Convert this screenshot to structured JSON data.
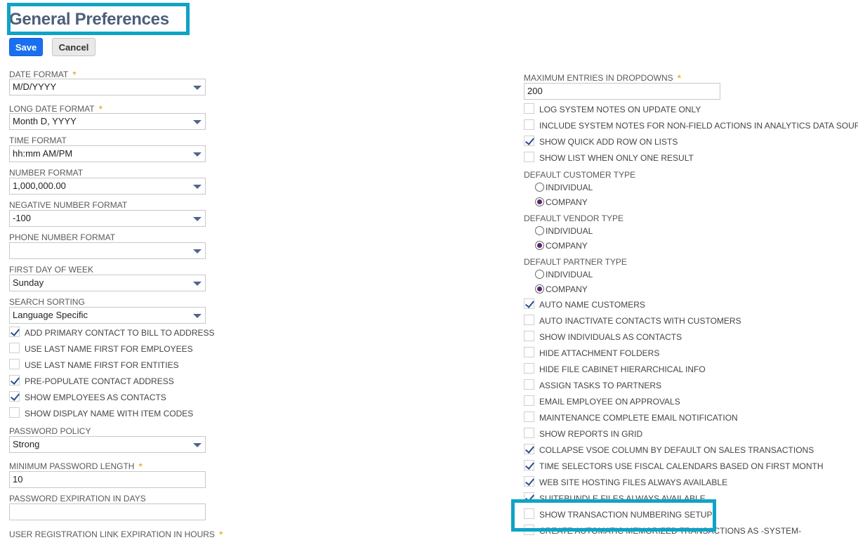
{
  "page": {
    "title": "General Preferences",
    "save_label": "Save",
    "cancel_label": "Cancel"
  },
  "left": {
    "date_format": {
      "label": "DATE FORMAT",
      "value": "M/D/YYYY"
    },
    "long_date_format": {
      "label": "LONG DATE FORMAT",
      "value": "Month D, YYYY"
    },
    "time_format": {
      "label": "TIME FORMAT",
      "value": "hh:mm AM/PM"
    },
    "number_format": {
      "label": "NUMBER FORMAT",
      "value": "1,000,000.00"
    },
    "negative_number_format": {
      "label": "NEGATIVE NUMBER FORMAT",
      "value": "-100"
    },
    "phone_number_format": {
      "label": "PHONE NUMBER FORMAT",
      "value": ""
    },
    "first_day_of_week": {
      "label": "FIRST DAY OF WEEK",
      "value": "Sunday"
    },
    "search_sorting": {
      "label": "SEARCH SORTING",
      "value": "Language Specific"
    },
    "checkboxes": [
      {
        "label": "ADD PRIMARY CONTACT TO BILL TO ADDRESS",
        "checked": true
      },
      {
        "label": "USE LAST NAME FIRST FOR EMPLOYEES",
        "checked": false
      },
      {
        "label": "USE LAST NAME FIRST FOR ENTITIES",
        "checked": false
      },
      {
        "label": "PRE-POPULATE CONTACT ADDRESS",
        "checked": true
      },
      {
        "label": "SHOW EMPLOYEES AS CONTACTS",
        "checked": true
      },
      {
        "label": "SHOW DISPLAY NAME WITH ITEM CODES",
        "checked": false
      }
    ],
    "password_policy": {
      "label": "PASSWORD POLICY",
      "value": "Strong"
    },
    "min_password_length": {
      "label": "MINIMUM PASSWORD LENGTH",
      "value": "10"
    },
    "password_expiration": {
      "label": "PASSWORD EXPIRATION IN DAYS",
      "value": ""
    },
    "user_registration_link": {
      "label": "USER REGISTRATION LINK EXPIRATION IN HOURS"
    }
  },
  "right": {
    "max_entries": {
      "label": "MAXIMUM ENTRIES IN DROPDOWNS",
      "value": "200"
    },
    "checkboxes_top": [
      {
        "label": "LOG SYSTEM NOTES ON UPDATE ONLY",
        "checked": false
      },
      {
        "label": "INCLUDE SYSTEM NOTES FOR NON-FIELD ACTIONS IN ANALYTICS DATA SOURCE",
        "checked": false
      },
      {
        "label": "SHOW QUICK ADD ROW ON LISTS",
        "checked": true
      },
      {
        "label": "SHOW LIST WHEN ONLY ONE RESULT",
        "checked": false
      }
    ],
    "default_customer_type": {
      "label": "DEFAULT CUSTOMER TYPE",
      "opt1": "INDIVIDUAL",
      "opt2": "COMPANY"
    },
    "default_vendor_type": {
      "label": "DEFAULT VENDOR TYPE",
      "opt1": "INDIVIDUAL",
      "opt2": "COMPANY"
    },
    "default_partner_type": {
      "label": "DEFAULT PARTNER TYPE",
      "opt1": "INDIVIDUAL",
      "opt2": "COMPANY"
    },
    "checkboxes_bottom": [
      {
        "label": "AUTO NAME CUSTOMERS",
        "checked": true
      },
      {
        "label": "AUTO INACTIVATE CONTACTS WITH CUSTOMERS",
        "checked": false
      },
      {
        "label": "SHOW INDIVIDUALS AS CONTACTS",
        "checked": false
      },
      {
        "label": "HIDE ATTACHMENT FOLDERS",
        "checked": false
      },
      {
        "label": "HIDE FILE CABINET HIERARCHICAL INFO",
        "checked": false
      },
      {
        "label": "ASSIGN TASKS TO PARTNERS",
        "checked": false
      },
      {
        "label": "EMAIL EMPLOYEE ON APPROVALS",
        "checked": false
      },
      {
        "label": "MAINTENANCE COMPLETE EMAIL NOTIFICATION",
        "checked": false
      },
      {
        "label": "SHOW REPORTS IN GRID",
        "checked": false
      },
      {
        "label": "COLLAPSE VSOE COLUMN BY DEFAULT ON SALES TRANSACTIONS",
        "checked": true
      },
      {
        "label": "TIME SELECTORS USE FISCAL CALENDARS BASED ON FIRST MONTH",
        "checked": true
      },
      {
        "label": "WEB SITE HOSTING FILES ALWAYS AVAILABLE",
        "checked": true
      },
      {
        "label": "SUITEBUNDLE FILES ALWAYS AVAILABLE",
        "checked": true
      },
      {
        "label": "SHOW TRANSACTION NUMBERING SETUP",
        "checked": false
      },
      {
        "label": "CREATE AUTOMATIC MEMORIZED TRANSACTIONS AS -SYSTEM-",
        "checked": false
      }
    ]
  },
  "colors": {
    "highlight": "#0fa3c6",
    "save_button": "#1a6ff0",
    "title": "#4d5f79"
  }
}
